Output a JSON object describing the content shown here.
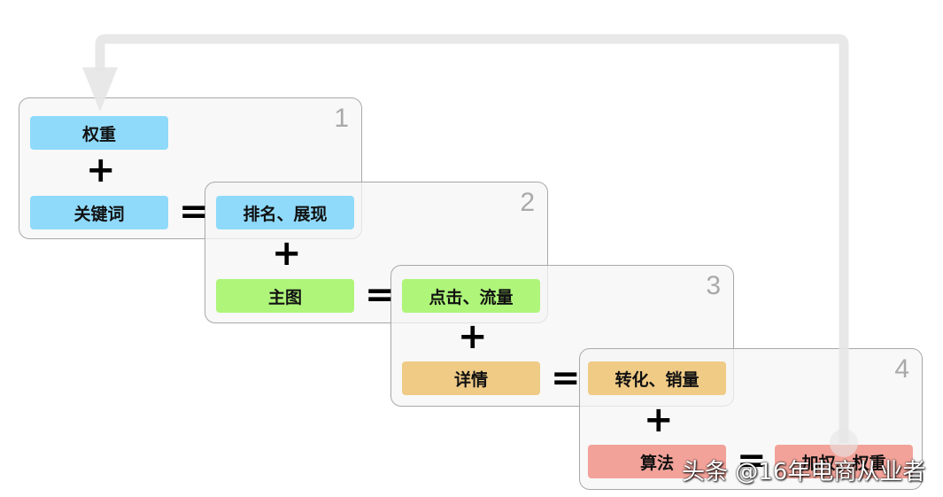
{
  "colors": {
    "blue": "#8fdafa",
    "green": "#aef57a",
    "orange": "#efcb86",
    "pink": "#f2a299",
    "arrow": "#e6e6e6"
  },
  "steps": [
    {
      "number": "1",
      "input_a": "权重",
      "input_b": "关键词",
      "result": "排名、展现"
    },
    {
      "number": "2",
      "input_b": "主图",
      "result": "点击、流量"
    },
    {
      "number": "3",
      "input_b": "详情",
      "result": "转化、销量"
    },
    {
      "number": "4",
      "input_b": "算法",
      "result": "加权、权重"
    }
  ],
  "operators": {
    "plus": "+",
    "equals": "="
  },
  "watermark": "头条 @16年电商从业者"
}
